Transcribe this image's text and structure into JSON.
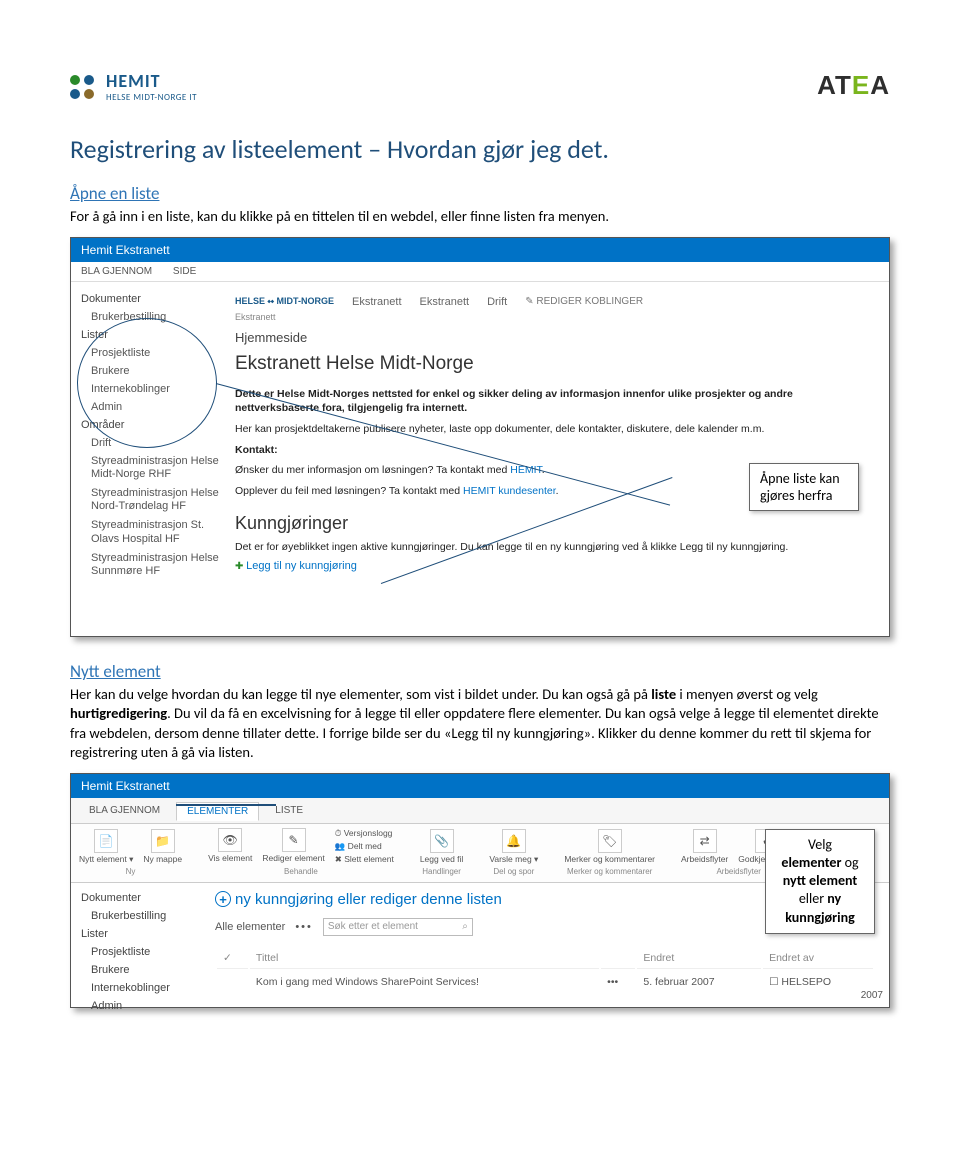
{
  "header": {
    "hemit_brand": "HEMIT",
    "hemit_sub": "HELSE MIDT-NORGE IT",
    "atea_brand": "ATEA"
  },
  "title": "Registrering av listeelement – Hvordan gjør jeg det.",
  "section1": {
    "heading": "Åpne en liste",
    "text": "For å gå inn i en liste, kan du klikke på en tittelen til en webdel, eller finne listen fra menyen."
  },
  "shot1": {
    "titlebar": "Hemit Ekstranett",
    "ribbon_tabs": [
      "BLA GJENNOM",
      "SIDE"
    ],
    "crumb_logo": "HELSE ⬩⬩ MIDT-NORGE",
    "crumb_items": [
      "Ekstranett",
      "Ekstranett",
      "Drift"
    ],
    "crumb_sub": "Ekstranett",
    "crumb_edit": "✎  REDIGER KOBLINGER",
    "leftnav": [
      "Dokumenter",
      "Brukerbestilling",
      "Lister",
      "Prosjektliste",
      "Brukere",
      "Internekoblinger",
      "Admin",
      "Områder",
      "Drift",
      "Styreadministrasjon Helse Midt-Norge RHF",
      "Styreadministrasjon Helse Nord-Trøndelag HF",
      "Styreadministrasjon St. Olavs Hospital HF",
      "Styreadministrasjon Helse Sunnmøre HF"
    ],
    "main_hjem": "Hjemmeside",
    "main_title": "Ekstranett Helse Midt-Norge",
    "main_p1": "Dette er Helse Midt-Norges nettsted for enkel og sikker deling av informasjon innenfor ulike prosjekter og andre nettverksbaserte fora, tilgjengelig fra internett.",
    "main_p2": "Her kan prosjektdeltakerne publisere nyheter, laste opp dokumenter, dele kontakter, diskutere, dele kalender m.m.",
    "main_kontakt": "Kontakt:",
    "main_k1a": "Ønsker du mer informasjon om løsningen? Ta kontakt med ",
    "main_k1b": "HEMIT",
    "main_k2a": "Opplever du feil med løsningen? Ta kontakt med ",
    "main_k2b": "HEMIT kundesenter",
    "kung_head": "Kunngjøringer",
    "kung_text": "Det er for øyeblikket ingen aktive kunngjøringer. Du kan legge til en ny kunngjøring ved å klikke Legg til ny kunngjøring.",
    "kung_add": "Legg til ny kunngjøring",
    "callout": "Åpne liste kan gjøres herfra"
  },
  "section2": {
    "heading": "Nytt element",
    "p1a": "Her kan du velge hvordan du kan legge til nye elementer, som vist i bildet under. Du kan også gå på ",
    "p1b": "liste",
    "p1c": " i menyen øverst og velg ",
    "p1d": "hurtigredigering",
    "p1e": ". Du vil da få en excelvisning for å legge til eller oppdatere flere elementer. Du kan også velge å legge til elementet direkte fra webdelen, dersom denne tillater dette. I forrige bilde ser du «Legg til ny kunngjøring». Klikker du denne kommer du rett til skjema for registrering uten å gå via listen."
  },
  "shot2": {
    "titlebar": "Hemit Ekstranett",
    "tabs": [
      "BLA GJENNOM",
      "ELEMENTER",
      "LISTE"
    ],
    "ribbon_items": [
      {
        "icon": "📄",
        "label": "Nytt element ▾"
      },
      {
        "icon": "📁",
        "label": "Ny mappe"
      },
      {
        "icon": "👁",
        "label": "Vis element"
      },
      {
        "icon": "✎",
        "label": "Rediger element"
      }
    ],
    "ribbon_stack1": [
      "⏱ Versjonslogg",
      "👥 Delt med",
      "✖ Slett element"
    ],
    "ribbon_items2": [
      {
        "icon": "📎",
        "label": "Legg ved fil"
      },
      {
        "icon": "🔔",
        "label": "Varsle meg ▾"
      },
      {
        "icon": "🏷",
        "label": "Merker og kommentarer"
      }
    ],
    "ribbon_items3": [
      {
        "icon": "⇄",
        "label": "Arbeidsflyter"
      },
      {
        "icon": "✔",
        "label": "Godkjenn/avvis"
      }
    ],
    "ribbon_sections": [
      "Ny",
      "Behandle",
      "Handlinger",
      "Del og spor",
      "Merker og kommentarer",
      "Arbeidsflyter"
    ],
    "leftnav": [
      "Dokumenter",
      "Brukerbestilling",
      "Lister",
      "Prosjektliste",
      "Brukere",
      "Internekoblinger",
      "Admin"
    ],
    "newk_text": "ny kunngjøring eller rediger denne listen",
    "filter_label": "Alle elementer",
    "search_placeholder": "Søk etter et element",
    "table_headers": [
      "✓",
      "Tittel",
      "",
      "Endret",
      "Endret av"
    ],
    "row1": [
      "",
      "Kom i gang med Windows SharePoint Services!",
      "•••",
      "5. februar 2007",
      "☐ HELSEPO"
    ],
    "row_tail": "2007",
    "callout_lines": [
      "Velg",
      "elementer",
      " og",
      "nytt element",
      "eller ",
      "ny",
      "kunngjøring"
    ]
  }
}
